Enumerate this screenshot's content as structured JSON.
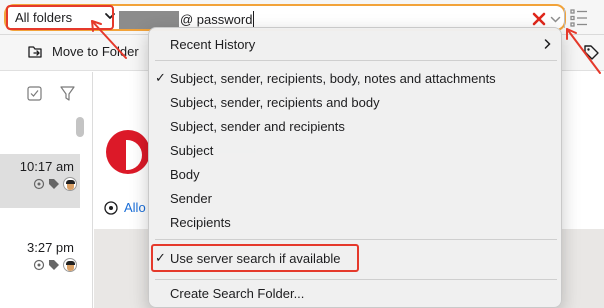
{
  "search": {
    "scope_value": "All folders",
    "query_text": "@ password"
  },
  "toolbar": {
    "move_label": "Move to Folder"
  },
  "message_list": {
    "rows": [
      {
        "time": "10:17 am"
      },
      {
        "time": "3:27 pm"
      }
    ]
  },
  "reading_pane": {
    "allow_label": "Allo"
  },
  "search_options_menu": {
    "recent_history": "Recent History",
    "fields_options": [
      {
        "label": "Subject, sender, recipients, body, notes and attachments",
        "checked": true
      },
      {
        "label": "Subject, sender, recipients and body",
        "checked": false
      },
      {
        "label": "Subject, sender and recipients",
        "checked": false
      },
      {
        "label": "Subject",
        "checked": false
      },
      {
        "label": "Body",
        "checked": false
      },
      {
        "label": "Sender",
        "checked": false
      },
      {
        "label": "Recipients",
        "checked": false
      }
    ],
    "server_search": {
      "label": "Use server search if available",
      "checked": true
    },
    "create_search_folder": "Create Search Folder...",
    "check_mark": "✓"
  },
  "colors": {
    "search_focus_ring": "#f2a33a",
    "annotation_red": "#e5392b",
    "link_blue": "#1a6ed8"
  },
  "icons": [
    "chevron-down-icon",
    "clear-x-icon",
    "filter-list-icon",
    "move-folder-icon",
    "tag-icon",
    "select-all-icon",
    "filter-icon",
    "flag-icon",
    "settings-icon",
    "chevron-right-icon",
    "allow-icon"
  ]
}
